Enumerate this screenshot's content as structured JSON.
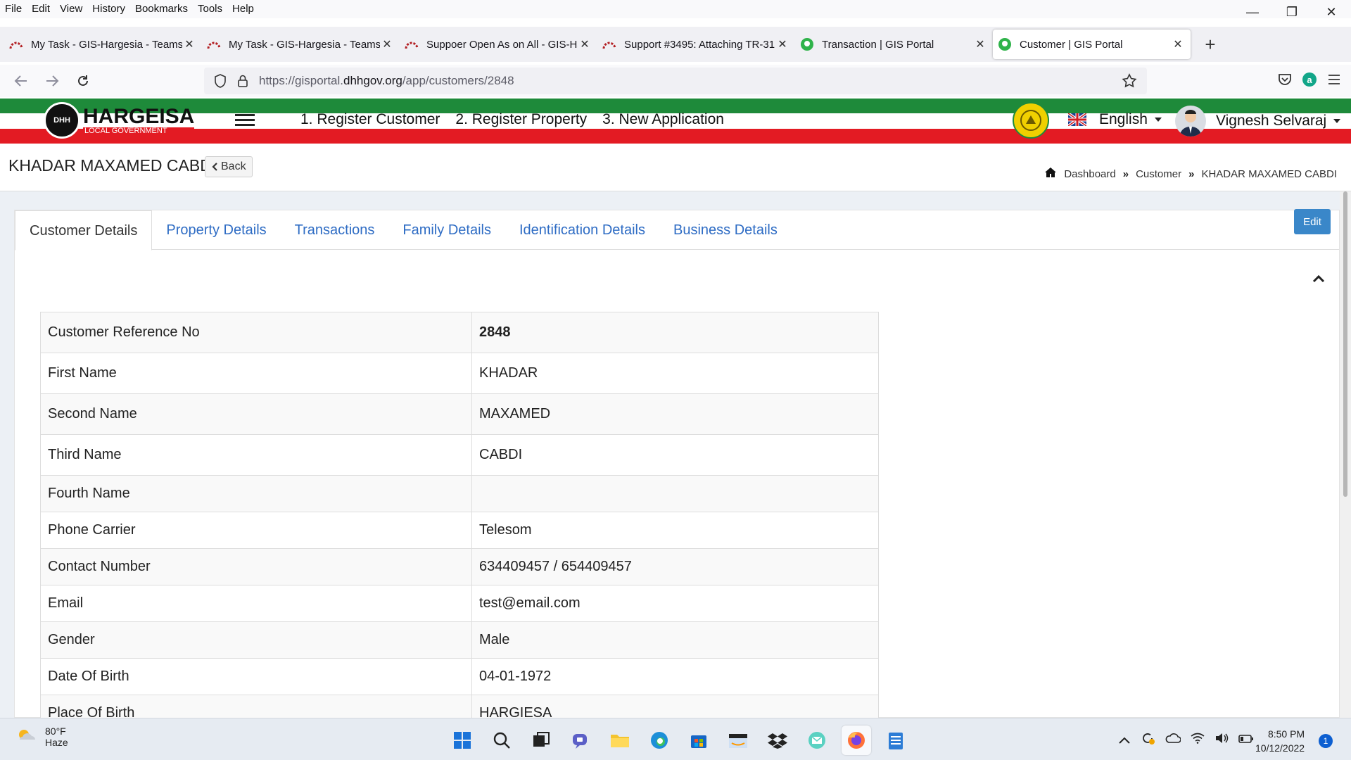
{
  "menubar": [
    "File",
    "Edit",
    "View",
    "History",
    "Bookmarks",
    "Tools",
    "Help"
  ],
  "window_controls": {
    "minimize": "—",
    "restore": "❐",
    "close": "✕"
  },
  "tabs": [
    {
      "title": "My Task - GIS-Hargesia - Teams",
      "icon": "redmine-icon",
      "close": "✕"
    },
    {
      "title": "My Task - GIS-Hargesia - Teams",
      "icon": "redmine-icon",
      "close": "✕"
    },
    {
      "title": "Suppoer Open As on All - GIS-Ha",
      "icon": "redmine-icon",
      "close": "✕"
    },
    {
      "title": "Support #3495: Attaching TR-31",
      "icon": "redmine-icon",
      "close": "✕"
    },
    {
      "title": "Transaction | GIS Portal",
      "icon": "gis-portal-icon",
      "close": "✕"
    },
    {
      "title": "Customer | GIS Portal",
      "icon": "gis-portal-icon",
      "close": "✕"
    }
  ],
  "new_tab": "+",
  "url": {
    "prefix": "https://gisportal.",
    "host": "dhhgov.org",
    "path": "/app/customers/2848"
  },
  "header": {
    "logo_main": "HARGEISA",
    "logo_sub": "LOCAL GOVERNMENT",
    "logo_badge": "DHH",
    "nav": [
      "1. Register Customer",
      "2. Register Property",
      "3. New Application"
    ],
    "language": "English",
    "user": "Vignesh Selvaraj"
  },
  "page": {
    "title": "KHADAR MAXAMED CABDI",
    "back": "Back",
    "breadcrumb": {
      "home": "Dashboard",
      "sep": "»",
      "customer": "Customer",
      "current": "KHADAR MAXAMED CABDI"
    }
  },
  "panel": {
    "tabs": [
      "Customer Details",
      "Property Details",
      "Transactions",
      "Family Details",
      "Identification Details",
      "Business Details"
    ],
    "edit": "Edit"
  },
  "details": [
    {
      "label": "Customer Reference No",
      "value": "2848"
    },
    {
      "label": "First Name",
      "value": "KHADAR"
    },
    {
      "label": "Second Name",
      "value": "MAXAMED"
    },
    {
      "label": "Third Name",
      "value": "CABDI"
    },
    {
      "label": "Fourth Name",
      "value": ""
    },
    {
      "label": "Phone Carrier",
      "value": "Telesom"
    },
    {
      "label": "Contact Number",
      "value": "634409457 / 654409457"
    },
    {
      "label": "Email",
      "value": "test@email.com"
    },
    {
      "label": "Gender",
      "value": "Male"
    },
    {
      "label": "Date Of Birth",
      "value": "04-01-1972"
    },
    {
      "label": "Place Of Birth",
      "value": "HARGIESA"
    }
  ],
  "taskbar": {
    "weather_temp": "80°F",
    "weather_desc": "Haze",
    "time": "8:50 PM",
    "date": "10/12/2022",
    "notifications": "1"
  },
  "colors": {
    "accent_blue": "#3a87c9",
    "link_blue": "#2e6cc4",
    "flag_green": "#1e8a3a",
    "flag_red": "#e31b23"
  }
}
